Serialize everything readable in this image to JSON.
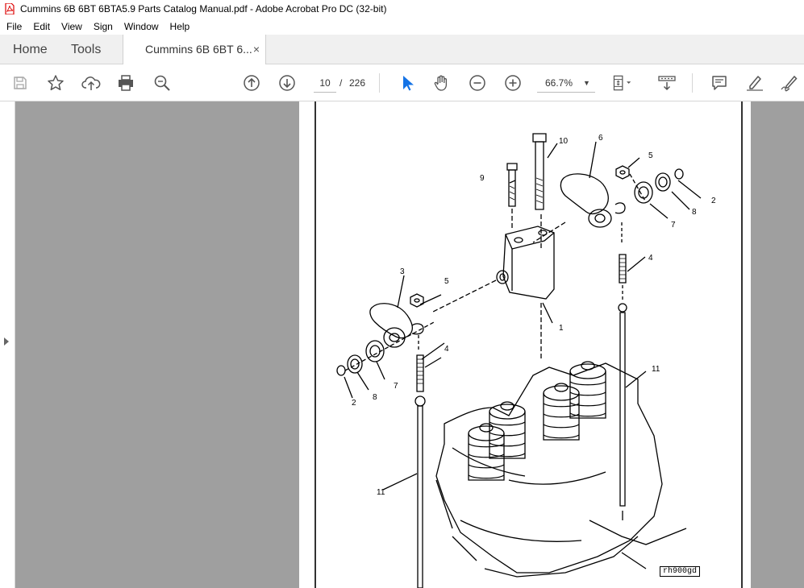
{
  "window": {
    "title": "Cummins 6B 6BT 6BTA5.9 Parts Catalog Manual.pdf - Adobe Acrobat Pro DC (32-bit)"
  },
  "menu": [
    "File",
    "Edit",
    "View",
    "Sign",
    "Window",
    "Help"
  ],
  "tabs": {
    "home": "Home",
    "tools": "Tools",
    "document": "Cummins 6B 6BT 6...",
    "close": "×"
  },
  "toolbar": {
    "page_current": "10",
    "page_separator": "/",
    "page_total": "226",
    "zoom": "66.7%"
  },
  "document": {
    "figure_label": "rh900gd",
    "callouts": [
      "10",
      "6",
      "9",
      "5",
      "2",
      "8",
      "7",
      "4",
      "3",
      "5",
      "1",
      "4",
      "7",
      "8",
      "2",
      "11",
      "11"
    ]
  }
}
